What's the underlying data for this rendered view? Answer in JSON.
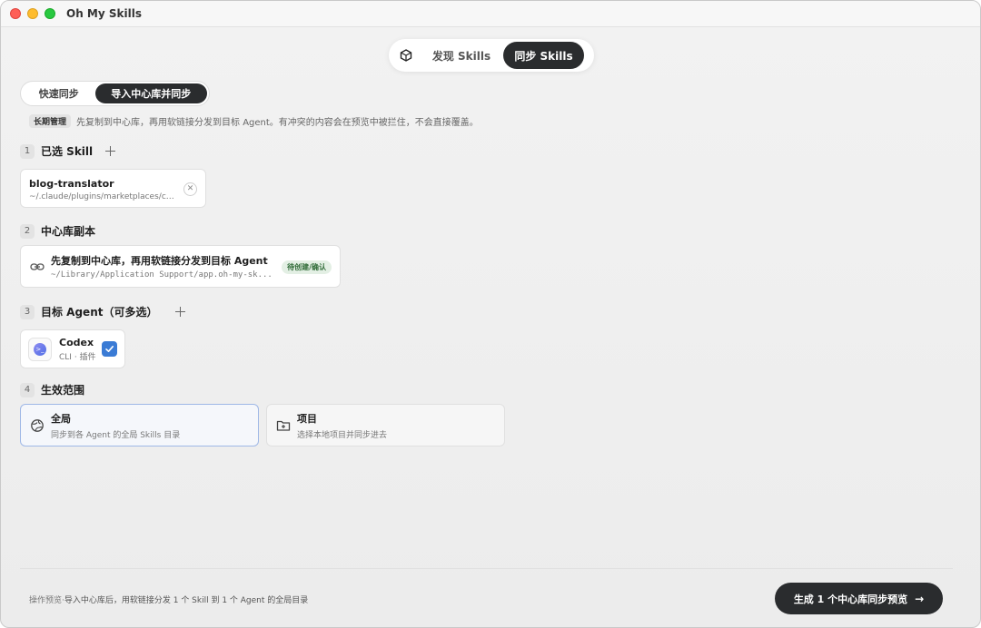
{
  "app": {
    "title": "Oh My Skills"
  },
  "top_tabs": {
    "discover": "发现 Skills",
    "sync": "同步 Skills",
    "active": "sync"
  },
  "mode_tabs": {
    "quick": "快速同步",
    "import": "导入中心库并同步",
    "active": "import"
  },
  "info": {
    "tag": "长期管理",
    "text": "先复制到中心库，再用软链接分发到目标 Agent。有冲突的内容会在预览中被拦住，不会直接覆盖。"
  },
  "sections": {
    "selected": {
      "num": "1",
      "title": "已选 Skill"
    },
    "library": {
      "num": "2",
      "title": "中心库副本"
    },
    "agents": {
      "num": "3",
      "title": "目标 Agent（可多选）"
    },
    "scope": {
      "num": "4",
      "title": "生效范围"
    }
  },
  "skill": {
    "name": "blog-translator",
    "path": "~/.claude/plugins/marketplaces/cai..."
  },
  "library": {
    "title": "先复制到中心库，再用软链接分发到目标 Agent",
    "path": "~/Library/Application Support/app.oh-my-sk...",
    "badge": "待创建/确认"
  },
  "agent": {
    "name": "Codex",
    "meta": "CLI · 插件",
    "checked": true
  },
  "scope": {
    "global": {
      "title": "全局",
      "desc": "同步到各 Agent 的全局 Skills 目录",
      "selected": true
    },
    "project": {
      "title": "项目",
      "desc": "选择本地项目并同步进去",
      "selected": false
    }
  },
  "footer": {
    "label": "操作预览·",
    "text": "导入中心库后，用软链接分发 1 个 Skill 到 1 个 Agent 的全局目录",
    "button": "生成 1 个中心库同步预览"
  },
  "colors": {
    "primary": "#2a2c2e",
    "accent": "#3a7bd5",
    "badge_bg": "#e3efe4",
    "badge_text": "#2f6b37"
  }
}
